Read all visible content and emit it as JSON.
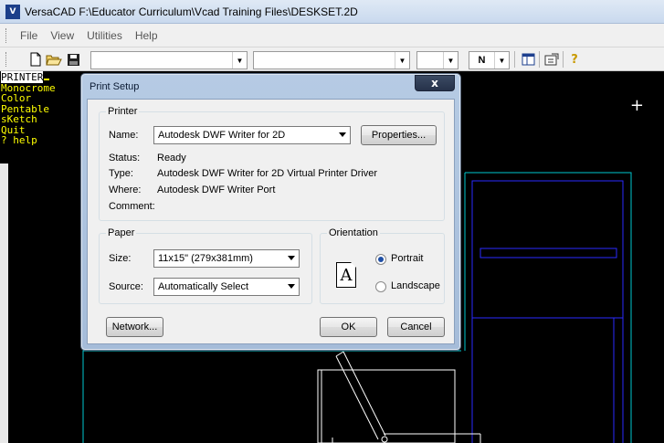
{
  "app": {
    "title": "VersaCAD  F:\\Educator Curriculum\\Vcad Training Files\\DESKSET.2D",
    "icon_text": "V"
  },
  "menu": [
    "File",
    "View",
    "Utilities",
    "Help"
  ],
  "toolbar": {
    "combo3_value": "",
    "combo4_value": "N"
  },
  "side_menu": {
    "items": [
      "PRINTER",
      "Monocrome",
      "Color",
      "Pentable",
      "sKetch",
      "Quit",
      "? help"
    ]
  },
  "dialog": {
    "title": "Print Setup",
    "close": "x",
    "printer": {
      "legend": "Printer",
      "name_label": "Name:",
      "name_value": "Autodesk DWF Writer for 2D",
      "properties_btn": "Properties...",
      "status_label": "Status:",
      "status_value": "Ready",
      "type_label": "Type:",
      "type_value": "Autodesk DWF Writer for 2D Virtual Printer Driver",
      "where_label": "Where:",
      "where_value": "Autodesk DWF Writer Port",
      "comment_label": "Comment:",
      "comment_value": ""
    },
    "paper": {
      "legend": "Paper",
      "size_label": "Size:",
      "size_value": "11x15\" (279x381mm)",
      "source_label": "Source:",
      "source_value": "Automatically Select"
    },
    "orientation": {
      "legend": "Orientation",
      "icon_letter": "A",
      "portrait": "Portrait",
      "landscape": "Landscape",
      "selected": "portrait"
    },
    "network_btn": "Network...",
    "ok_btn": "OK",
    "cancel_btn": "Cancel"
  },
  "colors": {
    "cad_bg": "#000000",
    "side_menu_text": "#ffff00",
    "draw_cyan": "#00c8d0",
    "draw_blue": "#2a2aff",
    "draw_white": "#ffffff"
  }
}
